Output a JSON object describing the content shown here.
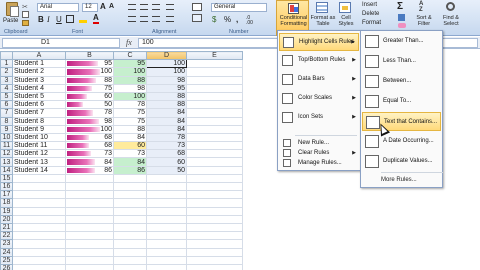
{
  "ribbon": {
    "paste_label": "Paste",
    "clipboard_group": "Clipboard",
    "font_group": "Font",
    "alignment_group": "Alignment",
    "number_group": "Number",
    "font_name": "Arial",
    "font_size": "12",
    "number_format": "General",
    "conditional_formatting": "Conditional Formatting",
    "format_as_table": "Format as Table",
    "cell_styles": "Cell Styles",
    "insert": "Insert",
    "delete": "Delete",
    "format": "Format",
    "sort_filter": "Sort & Filter",
    "find_select": "Find & Select"
  },
  "formula_bar": {
    "name_box": "D1",
    "fx": "fx",
    "value": "100"
  },
  "columns": [
    "A",
    "B",
    "C",
    "D",
    "E"
  ],
  "rows": [
    {
      "num": "1",
      "name": "Student 1",
      "b": 95,
      "c": 95,
      "d": 100
    },
    {
      "num": "2",
      "name": "Student 2",
      "b": 100,
      "c": 100,
      "d": 100
    },
    {
      "num": "3",
      "name": "Student 3",
      "b": 88,
      "c": 88,
      "d": 98
    },
    {
      "num": "4",
      "name": "Student 4",
      "b": 75,
      "c": 98,
      "d": 95
    },
    {
      "num": "5",
      "name": "Student 5",
      "b": 60,
      "c": 100,
      "d": 88
    },
    {
      "num": "6",
      "name": "Student 6",
      "b": 50,
      "c": 78,
      "d": 88
    },
    {
      "num": "7",
      "name": "Student 7",
      "b": 78,
      "c": 75,
      "d": 84
    },
    {
      "num": "8",
      "name": "Student 8",
      "b": 98,
      "c": 75,
      "d": 84
    },
    {
      "num": "9",
      "name": "Student 9",
      "b": 100,
      "c": 88,
      "d": 84
    },
    {
      "num": "10",
      "name": "Student 10",
      "b": 68,
      "c": 84,
      "d": 78
    },
    {
      "num": "11",
      "name": "Student 11",
      "b": 68,
      "c": 60,
      "d": 73
    },
    {
      "num": "12",
      "name": "Student 12",
      "b": 73,
      "c": 73,
      "d": 68
    },
    {
      "num": "13",
      "name": "Student 13",
      "b": 84,
      "c": 84,
      "d": 60
    },
    {
      "num": "14",
      "name": "Student 14",
      "b": 86,
      "c": 86,
      "d": 50
    }
  ],
  "empty_rows": [
    "15",
    "16",
    "17",
    "18",
    "19",
    "20",
    "21",
    "22",
    "23",
    "24",
    "25",
    "26"
  ],
  "column_c_fills": [
    "#c6efce",
    "#c6efce",
    "#c6efce",
    "",
    "#c6efce",
    "",
    "",
    "",
    "",
    "",
    "#ffeb9c",
    "",
    "#c6efce",
    "#c6efce"
  ],
  "cf_menu": {
    "items": [
      {
        "label": "Highlight Cells Rules",
        "icon": "highlight-cells-icon",
        "highlighted": true
      },
      {
        "label": "Top/Bottom Rules",
        "icon": "top-bottom-icon",
        "highlighted": false
      },
      {
        "label": "Data Bars",
        "icon": "data-bars-icon",
        "highlighted": false
      },
      {
        "label": "Color Scales",
        "icon": "color-scales-icon",
        "highlighted": false
      },
      {
        "label": "Icon Sets",
        "icon": "icon-sets-icon",
        "highlighted": false
      }
    ],
    "small_items": [
      {
        "label": "New Rule...",
        "icon": "new-rule-icon"
      },
      {
        "label": "Clear Rules",
        "icon": "clear-rules-icon"
      },
      {
        "label": "Manage Rules...",
        "icon": "manage-rules-icon"
      }
    ]
  },
  "hl_menu": {
    "items": [
      {
        "label": "Greater Than...",
        "icon": "greater-than-icon",
        "highlighted": false
      },
      {
        "label": "Less Than...",
        "icon": "less-than-icon",
        "highlighted": false
      },
      {
        "label": "Between...",
        "icon": "between-icon",
        "highlighted": false
      },
      {
        "label": "Equal To...",
        "icon": "equal-to-icon",
        "highlighted": false
      },
      {
        "label": "Text that Contains...",
        "icon": "text-contains-icon",
        "highlighted": true
      },
      {
        "label": "A Date Occurring...",
        "icon": "date-occurring-icon",
        "highlighted": false
      },
      {
        "label": "Duplicate Values...",
        "icon": "duplicate-values-icon",
        "highlighted": false
      }
    ],
    "more_rules": "More Rules..."
  },
  "colors": {
    "ribbon_accent": "#ffc85a",
    "green_fill": "#c6efce",
    "yellow_fill": "#ffeb9c",
    "data_bar": "#c02080"
  }
}
